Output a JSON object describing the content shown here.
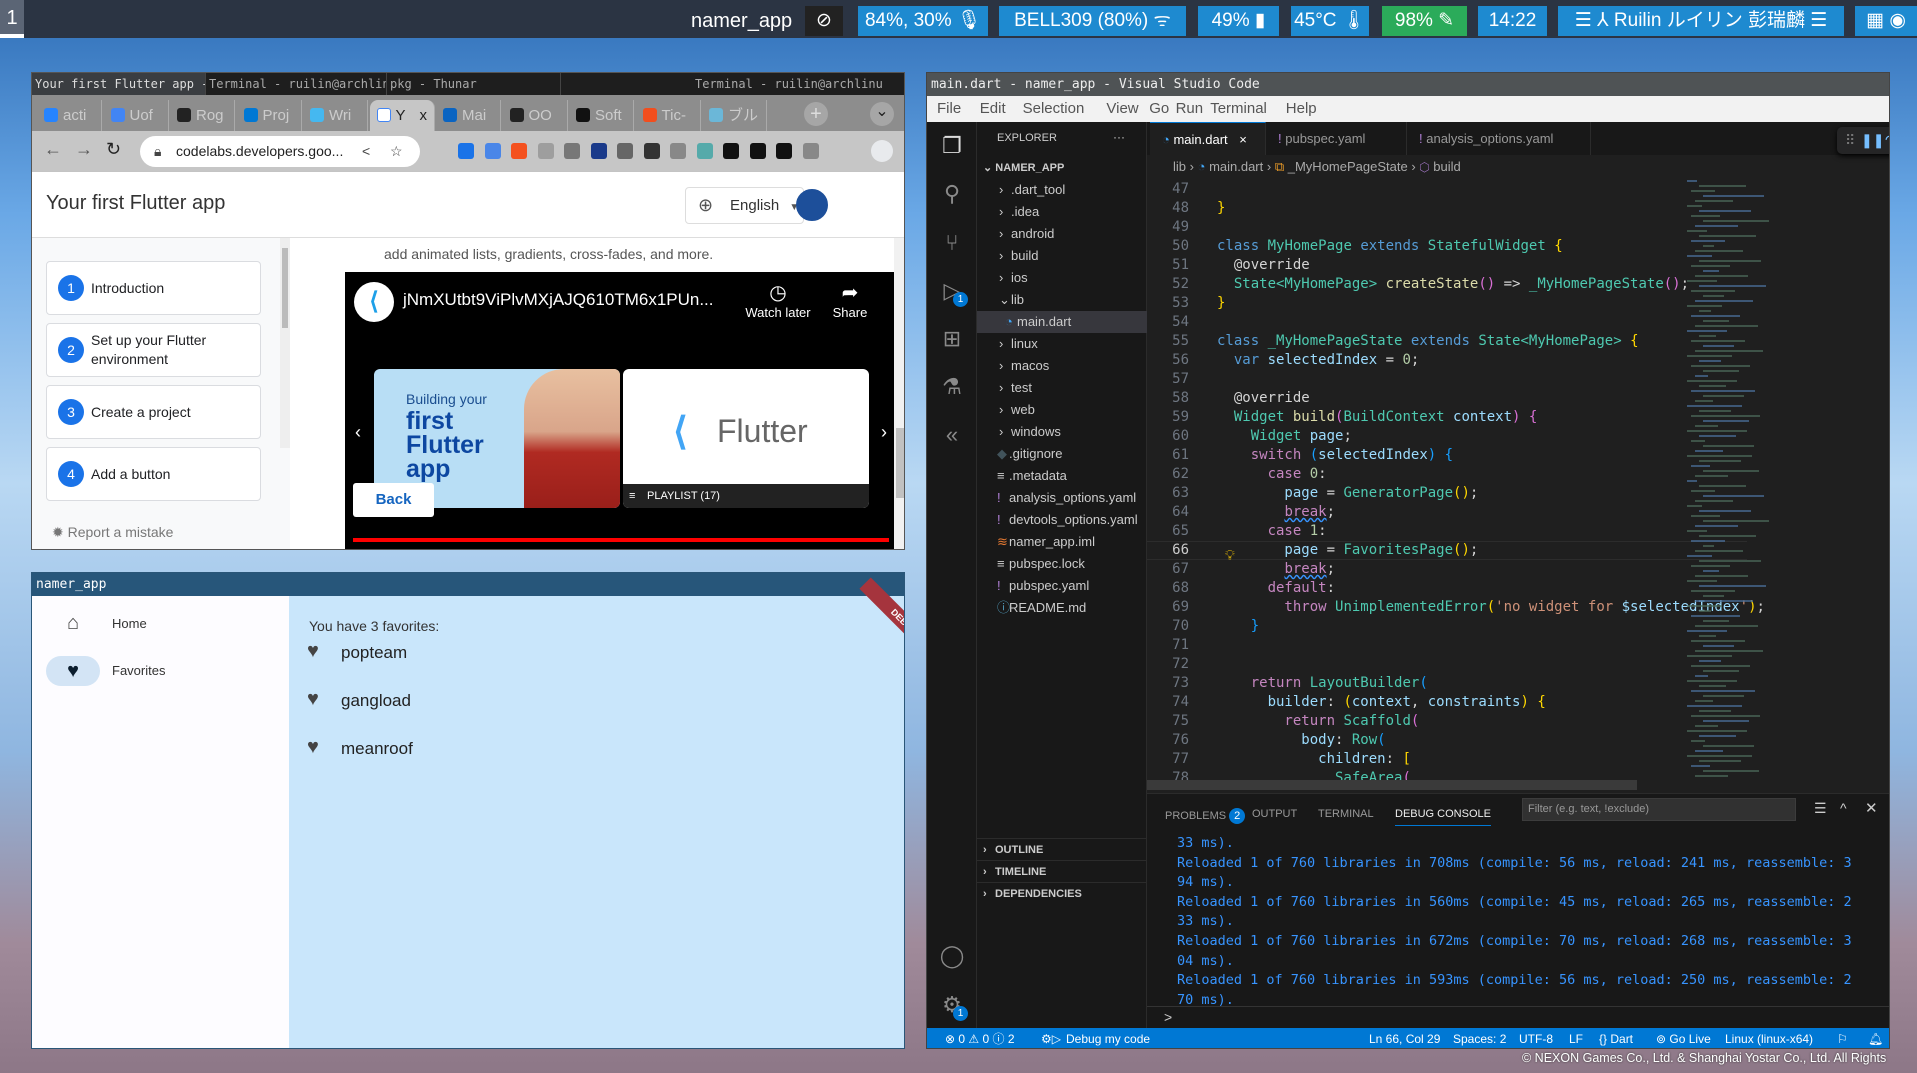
{
  "topbar": {
    "workspace": "1",
    "window_title": "namer_app",
    "privacy_icon": "eye-slash-icon",
    "volume": "84%, 30% 🎙",
    "wifi": "BELL309 (80%) ᯤ",
    "battery": "49% ▮",
    "temperature": "45°C 🌡",
    "brightness": "98% ✎",
    "clock": "14:22",
    "user": "☰ ⅄ Ruilin ルイリン 彭瑞麟 ☰",
    "tray": "▦ ◉"
  },
  "wm_tabs": [
    "Your first Flutter app - C",
    "Terminal - ruilin@archlinu",
    "pkg - Thunar",
    "Terminal - ruilin@archlinu"
  ],
  "browser": {
    "tabs": [
      {
        "label": "acti",
        "color": "#2684ff"
      },
      {
        "label": "Uof",
        "color": "#4285f4"
      },
      {
        "label": "Rog",
        "color": "#222"
      },
      {
        "label": "Proj",
        "color": "#0078d4"
      },
      {
        "label": "Wri",
        "color": "#45b8f0"
      },
      {
        "label": "Y",
        "color": "#ffffff",
        "active": true
      },
      {
        "label": "Mai",
        "color": "#0a64c2"
      },
      {
        "label": "OO",
        "color": "#222"
      },
      {
        "label": "Soft",
        "color": "#111"
      },
      {
        "label": "Tic-",
        "color": "#f24e1e"
      },
      {
        "label": "ブル",
        "color": "#6bb7d8"
      }
    ],
    "close_tab": "x",
    "new_tab": "+",
    "tab_menu": "⌄",
    "url": "codelabs.developers.goo...",
    "extensions": [
      "#1a73e8",
      "#4a86e8",
      "#f4511e",
      "#9e9e9e",
      "#777",
      "#1a3a8a",
      "#666",
      "#333",
      "#888",
      "#5aa",
      "#111",
      "#111",
      "#111",
      "#888"
    ],
    "page": {
      "title": "Your first Flutter app",
      "language": "English",
      "steps": [
        {
          "num": "1",
          "label": "Introduction"
        },
        {
          "num": "2",
          "label": "Set up your Flutter environment"
        },
        {
          "num": "3",
          "label": "Create a project"
        },
        {
          "num": "4",
          "label": "Add a button"
        }
      ],
      "report": "Report a mistake",
      "body_text": "add animated lists, gradients, cross-fades, and more.",
      "video": {
        "title": "jNmXUtbt9ViPlvMXjAJQ610TM6x1PUn...",
        "watch_later": "Watch later",
        "share": "Share",
        "thumb1_small": "Building your",
        "thumb1_big": "first Flutter app",
        "thumb2": "Flutter",
        "playlist": "PLAYLIST (17)",
        "back": "Back"
      }
    }
  },
  "namer": {
    "title": "namer_app",
    "nav": [
      {
        "label": "Home",
        "icon": "home-icon"
      },
      {
        "label": "Favorites",
        "icon": "heart-icon",
        "selected": true
      }
    ],
    "heading": "You have 3 favorites:",
    "favorites": [
      "popteam",
      "gangload",
      "meanroof"
    ],
    "debug_banner": "DEBUG"
  },
  "vscode": {
    "title": "main.dart - namer_app - Visual Studio Code",
    "menu": [
      "File",
      "Edit",
      "Selection",
      "View",
      "Go",
      "Run",
      "Terminal",
      "Help"
    ],
    "explorer_title": "EXPLORER",
    "explorer_more": "···",
    "project": "NAMER_APP",
    "tree": [
      {
        "label": ".dart_tool",
        "kind": "folder"
      },
      {
        "label": ".idea",
        "kind": "folder"
      },
      {
        "label": "android",
        "kind": "folder"
      },
      {
        "label": "build",
        "kind": "folder"
      },
      {
        "label": "ios",
        "kind": "folder"
      },
      {
        "label": "lib",
        "kind": "open-folder"
      },
      {
        "label": "main.dart",
        "kind": "dart",
        "selected": true
      },
      {
        "label": "linux",
        "kind": "folder"
      },
      {
        "label": "macos",
        "kind": "folder"
      },
      {
        "label": "test",
        "kind": "folder"
      },
      {
        "label": "web",
        "kind": "folder"
      },
      {
        "label": "windows",
        "kind": "folder"
      },
      {
        "label": ".gitignore",
        "kind": "git"
      },
      {
        "label": ".metadata",
        "kind": "text"
      },
      {
        "label": "analysis_options.yaml",
        "kind": "yaml"
      },
      {
        "label": "devtools_options.yaml",
        "kind": "yaml"
      },
      {
        "label": "namer_app.iml",
        "kind": "rss"
      },
      {
        "label": "pubspec.lock",
        "kind": "text"
      },
      {
        "label": "pubspec.yaml",
        "kind": "yaml"
      },
      {
        "label": "README.md",
        "kind": "info"
      }
    ],
    "sections": [
      "OUTLINE",
      "TIMELINE",
      "DEPENDENCIES"
    ],
    "run_badge": "1",
    "settings_badge": "1",
    "tabs": [
      {
        "label": "main.dart",
        "active": true,
        "close": "×"
      },
      {
        "label": "pubspec.yaml"
      },
      {
        "label": "analysis_options.yaml"
      }
    ],
    "breadcrumb": [
      "lib",
      "main.dart",
      "_MyHomePageState",
      "build"
    ],
    "current_line": 66,
    "code": [
      {
        "n": 47,
        "t": []
      },
      {
        "n": 48,
        "t": [
          [
            "}",
            "b1"
          ]
        ]
      },
      {
        "n": 49,
        "t": []
      },
      {
        "n": 50,
        "t": [
          [
            "class",
            "kw"
          ],
          [
            " ",
            "p"
          ],
          [
            "MyHomePage",
            "type"
          ],
          [
            " ",
            "p"
          ],
          [
            "extends",
            "kw"
          ],
          [
            " ",
            "p"
          ],
          [
            "StatefulWidget",
            "type"
          ],
          [
            " ",
            "p"
          ],
          [
            "{",
            "b1"
          ]
        ]
      },
      {
        "n": 51,
        "t": [
          [
            "  @override",
            "p"
          ]
        ]
      },
      {
        "n": 52,
        "t": [
          [
            "  State<MyHomePage>",
            "type"
          ],
          [
            " createState",
            "fn"
          ],
          [
            "()",
            "b2"
          ],
          [
            " => ",
            "p"
          ],
          [
            "_MyHomePageState",
            "type"
          ],
          [
            "()",
            "b2"
          ],
          [
            ";",
            "p"
          ]
        ]
      },
      {
        "n": 53,
        "t": [
          [
            "}",
            "b1"
          ]
        ]
      },
      {
        "n": 54,
        "t": []
      },
      {
        "n": 55,
        "t": [
          [
            "class",
            "kw"
          ],
          [
            " ",
            "p"
          ],
          [
            "_MyHomePageState",
            "type"
          ],
          [
            " ",
            "p"
          ],
          [
            "extends",
            "kw"
          ],
          [
            " ",
            "p"
          ],
          [
            "State<MyHomePage>",
            "type"
          ],
          [
            " ",
            "p"
          ],
          [
            "{",
            "b1"
          ]
        ]
      },
      {
        "n": 56,
        "t": [
          [
            "  var",
            "kw"
          ],
          [
            " selectedIndex",
            "var"
          ],
          [
            " = ",
            "p"
          ],
          [
            "0",
            "num"
          ],
          [
            ";",
            "p"
          ]
        ]
      },
      {
        "n": 57,
        "t": []
      },
      {
        "n": 58,
        "t": [
          [
            "  @override",
            "p"
          ]
        ]
      },
      {
        "n": 59,
        "t": [
          [
            "  Widget",
            "type"
          ],
          [
            " build",
            "fn"
          ],
          [
            "(",
            "b2"
          ],
          [
            "BuildContext",
            "type"
          ],
          [
            " context",
            "var"
          ],
          [
            ")",
            "b2"
          ],
          [
            " ",
            "p"
          ],
          [
            "{",
            "b2"
          ]
        ]
      },
      {
        "n": 60,
        "t": [
          [
            "    Widget",
            "type"
          ],
          [
            " page",
            "var"
          ],
          [
            ";",
            "p"
          ]
        ]
      },
      {
        "n": 61,
        "t": [
          [
            "    switch",
            "ctl"
          ],
          [
            " ",
            "p"
          ],
          [
            "(",
            "b3"
          ],
          [
            "selectedIndex",
            "var"
          ],
          [
            ")",
            "b3"
          ],
          [
            " ",
            "p"
          ],
          [
            "{",
            "b3"
          ]
        ]
      },
      {
        "n": 62,
        "t": [
          [
            "      case",
            "ctl"
          ],
          [
            " ",
            "p"
          ],
          [
            "0",
            "num"
          ],
          [
            ":",
            "p"
          ]
        ]
      },
      {
        "n": 63,
        "t": [
          [
            "        page",
            "var"
          ],
          [
            " = ",
            "p"
          ],
          [
            "GeneratorPage",
            "type"
          ],
          [
            "()",
            "b1"
          ],
          [
            ";",
            "p"
          ]
        ]
      },
      {
        "n": 64,
        "t": [
          [
            "        ",
            "p"
          ],
          [
            "break",
            "sq"
          ],
          [
            ";",
            "p"
          ]
        ]
      },
      {
        "n": 65,
        "t": [
          [
            "      case",
            "ctl"
          ],
          [
            " ",
            "p"
          ],
          [
            "1",
            "num"
          ],
          [
            ":",
            "p"
          ]
        ]
      },
      {
        "n": 66,
        "t": [
          [
            "        page",
            "var"
          ],
          [
            " = ",
            "p"
          ],
          [
            "FavoritesPage",
            "type"
          ],
          [
            "()",
            "b1"
          ],
          [
            ";",
            "p"
          ]
        ]
      },
      {
        "n": 67,
        "t": [
          [
            "        ",
            "p"
          ],
          [
            "break",
            "sq"
          ],
          [
            ";",
            "p"
          ]
        ]
      },
      {
        "n": 68,
        "t": [
          [
            "      default",
            "ctl"
          ],
          [
            ":",
            "p"
          ]
        ]
      },
      {
        "n": 69,
        "t": [
          [
            "        throw",
            "ctl"
          ],
          [
            " ",
            "p"
          ],
          [
            "UnimplementedError",
            "type"
          ],
          [
            "(",
            "b1"
          ],
          [
            "'no widget for ",
            "str"
          ],
          [
            "$selectedIndex",
            "var"
          ],
          [
            "'",
            "str"
          ],
          [
            ")",
            "b1"
          ],
          [
            ";",
            "p"
          ]
        ]
      },
      {
        "n": 70,
        "t": [
          [
            "    ",
            "p"
          ],
          [
            "}",
            "b3"
          ]
        ]
      },
      {
        "n": 71,
        "t": []
      },
      {
        "n": 72,
        "t": []
      },
      {
        "n": 73,
        "t": [
          [
            "    return",
            "ctl"
          ],
          [
            " ",
            "p"
          ],
          [
            "LayoutBuilder",
            "type"
          ],
          [
            "(",
            "b3"
          ]
        ]
      },
      {
        "n": 74,
        "t": [
          [
            "      builder",
            "var"
          ],
          [
            ": ",
            "p"
          ],
          [
            "(",
            "b1"
          ],
          [
            "context",
            "var"
          ],
          [
            ", ",
            "p"
          ],
          [
            "constraints",
            "var"
          ],
          [
            ")",
            "b1"
          ],
          [
            " ",
            "p"
          ],
          [
            "{",
            "b1"
          ]
        ]
      },
      {
        "n": 75,
        "t": [
          [
            "        return",
            "ctl"
          ],
          [
            " ",
            "p"
          ],
          [
            "Scaffold",
            "type"
          ],
          [
            "(",
            "b2"
          ]
        ]
      },
      {
        "n": 76,
        "t": [
          [
            "          body",
            "var"
          ],
          [
            ": ",
            "p"
          ],
          [
            "Row",
            "type"
          ],
          [
            "(",
            "b3"
          ]
        ]
      },
      {
        "n": 77,
        "t": [
          [
            "            children",
            "var"
          ],
          [
            ": ",
            "p"
          ],
          [
            "[",
            "b1"
          ]
        ]
      },
      {
        "n": 78,
        "t": [
          [
            "              SafeArea",
            "type"
          ],
          [
            "(",
            "b2"
          ]
        ]
      }
    ],
    "panel": {
      "tabs": [
        {
          "label": "PROBLEMS",
          "badge": "2"
        },
        {
          "label": "OUTPUT"
        },
        {
          "label": "TERMINAL"
        },
        {
          "label": "DEBUG CONSOLE",
          "active": true
        }
      ],
      "filter_placeholder": "Filter (e.g. text, !exclude)",
      "console": [
        "33 ms).",
        "Reloaded 1 of 760 libraries in 708ms (compile: 56 ms, reload: 241 ms, reassemble: 3",
        "94 ms).",
        "Reloaded 1 of 760 libraries in 560ms (compile: 45 ms, reload: 265 ms, reassemble: 2",
        "33 ms).",
        "Reloaded 1 of 760 libraries in 672ms (compile: 70 ms, reload: 268 ms, reassemble: 3",
        "04 ms).",
        "Reloaded 1 of 760 libraries in 593ms (compile: 56 ms, reload: 250 ms, reassemble: 2",
        "70 ms)."
      ],
      "prompt": ">"
    },
    "status": {
      "problems": "⊗ 0 ⚠ 0 ⓘ 2",
      "debug": "Debug my code",
      "position": "Ln 66, Col 29",
      "spaces": "Spaces: 2",
      "encoding": "UTF-8",
      "eol": "LF",
      "language": "{} Dart",
      "golive": "Go Live",
      "device": "Linux (linux-x64)"
    }
  },
  "copyright": "© NEXON Games Co., Ltd. & Shanghai Yostar Co., Ltd. All Rights"
}
